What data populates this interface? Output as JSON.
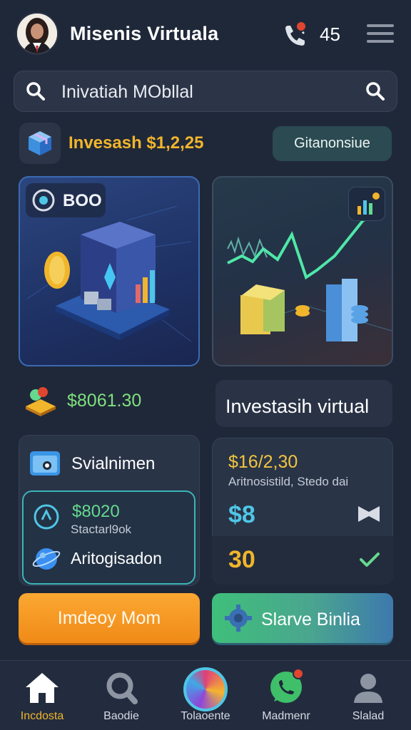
{
  "header": {
    "title": "Misenis Virtuala",
    "count": "45",
    "icons": [
      "avatar",
      "phone-icon",
      "menu-icon"
    ]
  },
  "search": {
    "text": "Inivatiah MObllal"
  },
  "invest": {
    "label": "Invesash $1,2,25",
    "button": "Gitanonsiue"
  },
  "card_left": {
    "chip": "BOO"
  },
  "balance": {
    "amount": "$8061.30",
    "chip": "Investasih virtual"
  },
  "panel_left": {
    "title": "Svialnimen",
    "amount": "$8020",
    "subtitle": "Stactarl9ok",
    "label": "Aritogisadon"
  },
  "panel_right": {
    "amount": "$16/2,30",
    "subtitle": "Aritnosistild, Stedo dai",
    "big_value": "$8",
    "number": "30"
  },
  "actions": {
    "primary": "Imdeoy Mom",
    "secondary": "Slarve Binlia"
  },
  "nav": {
    "items": [
      {
        "label": "Incdosta",
        "icon": "home-icon"
      },
      {
        "label": "Baodie",
        "icon": "search-icon"
      },
      {
        "label": "Tolaoente",
        "icon": "color-wheel-icon"
      },
      {
        "label": "Madmenr",
        "icon": "chat-icon"
      },
      {
        "label": "Slalad",
        "icon": "profile-icon"
      }
    ]
  },
  "colors": {
    "background": "#1f2839",
    "gold": "#f1b52b",
    "green": "#65d98e",
    "cyan": "#4fc6e6",
    "orange": "#f08a17"
  }
}
